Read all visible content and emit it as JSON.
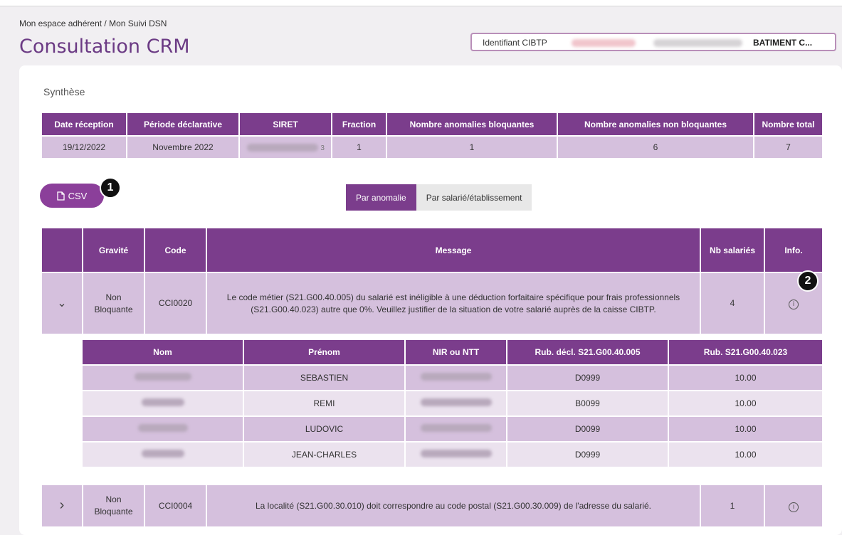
{
  "header": {
    "breadcrumb": "Mon espace adhérent / Mon Suivi DSN",
    "title": "Consultation CRM",
    "identifiant_label": "Identifiant CIBTP",
    "company": "BATIMENT C..."
  },
  "synthese": {
    "title": "Synthèse",
    "columns": [
      "Date réception",
      "Période déclarative",
      "SIRET",
      "Fraction",
      "Nombre anomalies bloquantes",
      "Nombre anomalies non bloquantes",
      "Nombre total"
    ],
    "row": {
      "date_reception": "19/12/2022",
      "periode": "Novembre 2022",
      "siret_suffix": "3",
      "fraction": "1",
      "bloquantes": "1",
      "non_bloquantes": "6",
      "total": "7"
    }
  },
  "actions": {
    "csv_label": "CSV",
    "badge_1": "1",
    "badge_2": "2"
  },
  "tabs": {
    "par_anomalie": "Par anomalie",
    "par_salarie": "Par salarié/établissement"
  },
  "anomalies": {
    "columns": [
      "",
      "Gravité",
      "Code",
      "Message",
      "Nb salariés",
      "Info."
    ],
    "rows": [
      {
        "chevron": "⌄",
        "gravite": "Non Bloquante",
        "code": "CCI0020",
        "message": "Le code métier (S21.G00.40.005) du salarié est inéligible à une déduction forfaitaire spécifique pour frais professionnels (S21.G00.40.023) autre que 0%. Veuillez justifier de la situation de votre salarié auprès de la caisse CIBTP.",
        "nb": "4"
      },
      {
        "chevron": "›",
        "gravite": "Non Bloquante",
        "code": "CCI0004",
        "message": "La localité (S21.G00.30.010) doit correspondre au code postal (S21.G00.30.009) de l'adresse du salarié.",
        "nb": "1"
      }
    ]
  },
  "salaries": {
    "columns": [
      "Nom",
      "Prénom",
      "NIR ou NTT",
      "Rub. décl. S21.G00.40.005",
      "Rub. S21.G00.40.023"
    ],
    "rows": [
      {
        "prenom": "SEBASTIEN",
        "rub005": "D0999",
        "rub023": "10.00"
      },
      {
        "prenom": "REMI",
        "rub005": "B0099",
        "rub023": "10.00"
      },
      {
        "prenom": "LUDOVIC",
        "rub005": "D0099",
        "rub023": "10.00"
      },
      {
        "prenom": "JEAN-CHARLES",
        "rub005": "D0999",
        "rub023": "10.00"
      }
    ]
  },
  "icons": {
    "info": "ⓘ",
    "file": "file-icon"
  },
  "colors": {
    "primary": "#7b3d8c",
    "row": "#d5c0dd",
    "row_alt": "#ebe2ee",
    "title": "#6b3a84"
  }
}
